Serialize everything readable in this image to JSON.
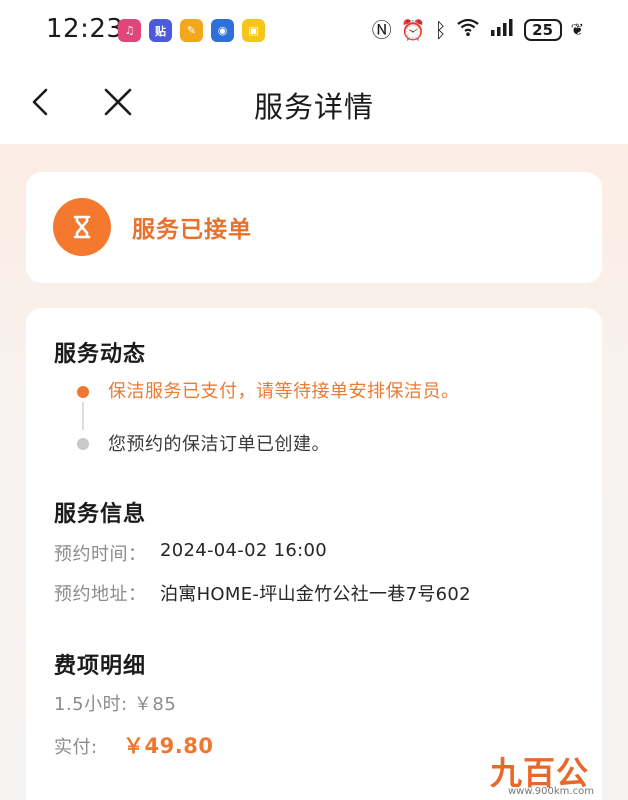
{
  "status_bar": {
    "time": "12:23",
    "battery": "25",
    "app_icons": [
      {
        "name": "music-app-icon",
        "color": "#e0457b",
        "glyph": "♫"
      },
      {
        "name": "tieba-app-icon",
        "color": "#4b5bdc",
        "glyph": "贴"
      },
      {
        "name": "notes-app-icon",
        "color": "#f2a81d",
        "glyph": "✎"
      },
      {
        "name": "camera-app-icon",
        "color": "#2e6fd8",
        "glyph": "◉"
      },
      {
        "name": "shop-app-icon",
        "color": "#f5c518",
        "glyph": "▣"
      }
    ]
  },
  "nav": {
    "title": "服务详情"
  },
  "status_card": {
    "text": "服务已接单",
    "accent": "#f5782f"
  },
  "service_dynamics": {
    "title": "服务动态",
    "timeline": [
      {
        "text": "保洁服务已支付，请等待接单安排保洁员。",
        "active": true
      },
      {
        "text": "您预约的保洁订单已创建。",
        "active": false
      }
    ]
  },
  "service_info": {
    "title": "服务信息",
    "rows": [
      {
        "label": "预约时间：",
        "value": "2024-04-02 16:00"
      },
      {
        "label": "预约地址：",
        "value": "泊寓HOME-坪山金竹公社一巷7号602"
      }
    ]
  },
  "fees": {
    "title": "费项明细",
    "item": "1.5小时:   ￥85",
    "paid_label": "实付:",
    "paid_amount": "￥49.80"
  },
  "watermark": {
    "main": "九百公里",
    "sub": "www.900km.com"
  }
}
